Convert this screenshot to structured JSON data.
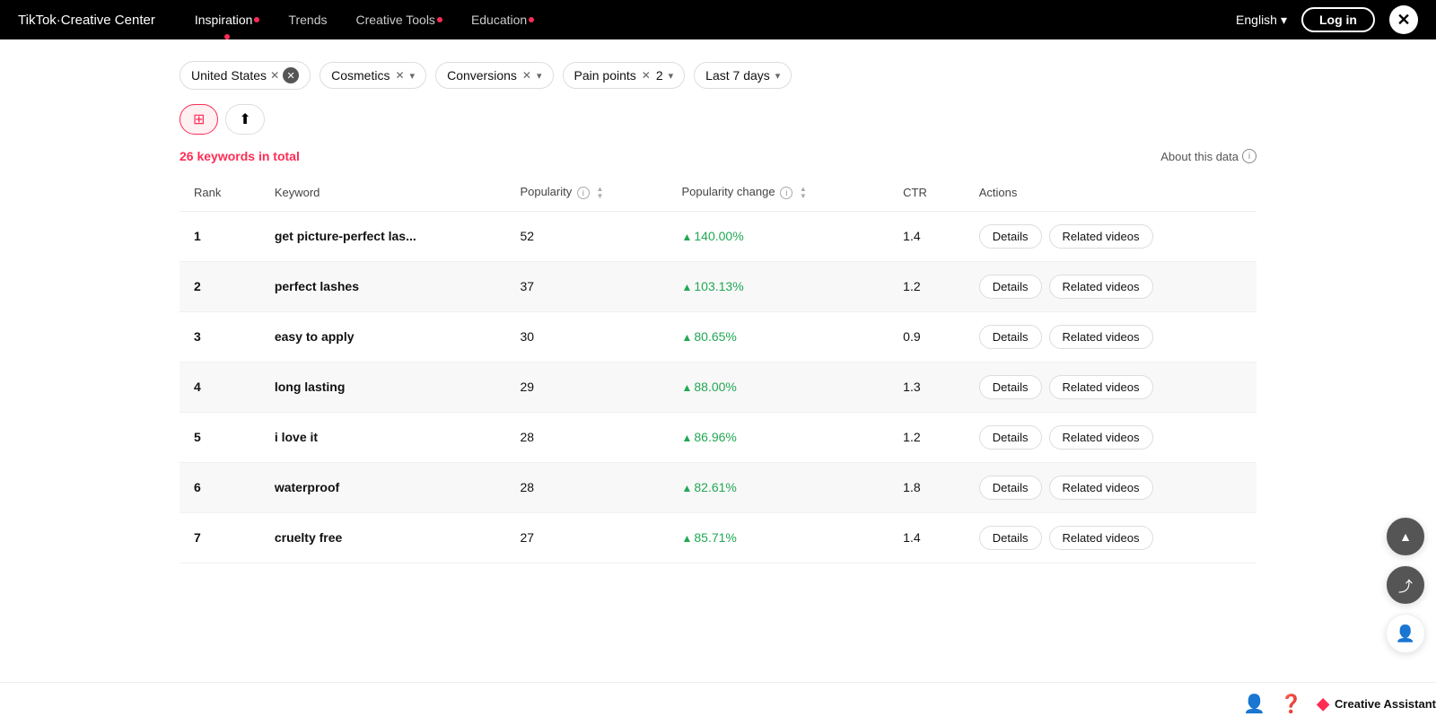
{
  "navbar": {
    "logo": "TikTok",
    "logo_sub": "Creative Center",
    "nav_items": [
      {
        "label": "Inspiration",
        "active": true,
        "has_dot": true
      },
      {
        "label": "Trends",
        "active": false,
        "has_dot": false
      },
      {
        "label": "Creative Tools",
        "active": false,
        "has_dot": true
      },
      {
        "label": "Education",
        "active": false,
        "has_dot": true
      }
    ],
    "lang": "English",
    "login": "Log in"
  },
  "filters": {
    "country": "United States",
    "category": "Cosmetics",
    "objective": "Conversions",
    "scene": "Pain points",
    "scene_count": "2",
    "date": "Last 7 days"
  },
  "summary": {
    "count": "26",
    "label": "keywords in total",
    "about": "About this data"
  },
  "table": {
    "columns": {
      "rank": "Rank",
      "keyword": "Keyword",
      "popularity": "Popularity",
      "popularity_change": "Popularity change",
      "ctr": "CTR",
      "actions": "Actions"
    },
    "rows": [
      {
        "rank": "1",
        "keyword": "get picture-perfect las...",
        "popularity": "52",
        "pop_change": "140.00%",
        "ctr": "1.4",
        "details": "Details",
        "related": "Related videos"
      },
      {
        "rank": "2",
        "keyword": "perfect lashes",
        "popularity": "37",
        "pop_change": "103.13%",
        "ctr": "1.2",
        "details": "Details",
        "related": "Related videos"
      },
      {
        "rank": "3",
        "keyword": "easy to apply",
        "popularity": "30",
        "pop_change": "80.65%",
        "ctr": "0.9",
        "details": "Details",
        "related": "Related videos"
      },
      {
        "rank": "4",
        "keyword": "long lasting",
        "popularity": "29",
        "pop_change": "88.00%",
        "ctr": "1.3",
        "details": "Details",
        "related": "Related videos"
      },
      {
        "rank": "5",
        "keyword": "i love it",
        "popularity": "28",
        "pop_change": "86.96%",
        "ctr": "1.2",
        "details": "Details",
        "related": "Related videos"
      },
      {
        "rank": "6",
        "keyword": "waterproof",
        "popularity": "28",
        "pop_change": "82.61%",
        "ctr": "1.8",
        "details": "Details",
        "related": "Related videos"
      },
      {
        "rank": "7",
        "keyword": "cruelty free",
        "popularity": "27",
        "pop_change": "85.71%",
        "ctr": "1.4",
        "details": "Details",
        "related": "Related videos"
      }
    ]
  },
  "creative_assistant": {
    "label": "Creative Assistant"
  }
}
